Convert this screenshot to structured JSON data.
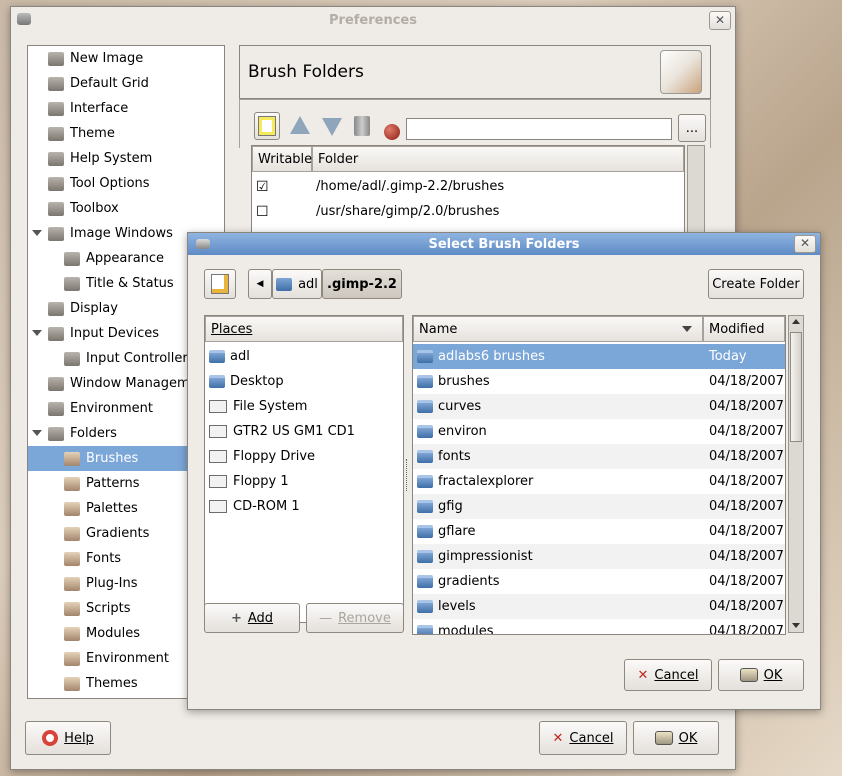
{
  "preferences": {
    "title": "Preferences",
    "close_glyph": "✕",
    "nav": [
      {
        "label": "New Image"
      },
      {
        "label": "Default Grid"
      },
      {
        "label": "Interface"
      },
      {
        "label": "Theme"
      },
      {
        "label": "Help System"
      },
      {
        "label": "Tool Options"
      },
      {
        "label": "Toolbox"
      },
      {
        "label": "Image Windows"
      },
      {
        "label": "Appearance"
      },
      {
        "label": "Title & Status"
      },
      {
        "label": "Display"
      },
      {
        "label": "Input Devices"
      },
      {
        "label": "Input Controllers"
      },
      {
        "label": "Window Management"
      },
      {
        "label": "Environment"
      },
      {
        "label": "Folders"
      },
      {
        "label": "Brushes"
      },
      {
        "label": "Patterns"
      },
      {
        "label": "Palettes"
      },
      {
        "label": "Gradients"
      },
      {
        "label": "Fonts"
      },
      {
        "label": "Plug-Ins"
      },
      {
        "label": "Scripts"
      },
      {
        "label": "Modules"
      },
      {
        "label": "Environment"
      },
      {
        "label": "Themes"
      }
    ],
    "section_title": "Brush Folders",
    "folder_path_value": "",
    "browse_label": "...",
    "table_headers": {
      "writable": "Writable",
      "folder": "Folder"
    },
    "folders": [
      {
        "writable": "☑",
        "path": "/home/adl/.gimp-2.2/brushes"
      },
      {
        "writable": "☐",
        "path": "/usr/share/gimp/2.0/brushes"
      }
    ],
    "help_label": "Help",
    "cancel_label": "Cancel",
    "ok_label": "OK"
  },
  "dialog": {
    "title": "Select Brush Folders",
    "close_glyph": "✕",
    "breadcrumb": {
      "back_glyph": "◀",
      "home": "adl",
      "current": ".gimp-2.2"
    },
    "create_folder_label": "Create Folder",
    "places_header": "Places",
    "places": [
      {
        "label": "adl",
        "icon": "home-icon"
      },
      {
        "label": "Desktop",
        "icon": "desktop-icon"
      },
      {
        "label": "File System",
        "icon": "drive-icon"
      },
      {
        "label": "GTR2 US GM1 CD1",
        "icon": "drive-icon"
      },
      {
        "label": "Floppy Drive",
        "icon": "drive-icon"
      },
      {
        "label": "Floppy 1",
        "icon": "drive-icon"
      },
      {
        "label": "CD-ROM 1",
        "icon": "drive-icon"
      }
    ],
    "add_label": "Add",
    "remove_label": "Remove",
    "files_header": {
      "name": "Name",
      "modified": "Modified"
    },
    "files": [
      {
        "name": "adlabs6 brushes",
        "modified": "Today"
      },
      {
        "name": "brushes",
        "modified": "04/18/2007"
      },
      {
        "name": "curves",
        "modified": "04/18/2007"
      },
      {
        "name": "environ",
        "modified": "04/18/2007"
      },
      {
        "name": "fonts",
        "modified": "04/18/2007"
      },
      {
        "name": "fractalexplorer",
        "modified": "04/18/2007"
      },
      {
        "name": "gfig",
        "modified": "04/18/2007"
      },
      {
        "name": "gflare",
        "modified": "04/18/2007"
      },
      {
        "name": "gimpressionist",
        "modified": "04/18/2007"
      },
      {
        "name": "gradients",
        "modified": "04/18/2007"
      },
      {
        "name": "levels",
        "modified": "04/18/2007"
      },
      {
        "name": "modules",
        "modified": "04/18/2007"
      }
    ],
    "cancel_label": "Cancel",
    "ok_label": "OK"
  },
  "colors": {
    "selection": "#7ba6d8",
    "window_bg": "#efebe7"
  }
}
